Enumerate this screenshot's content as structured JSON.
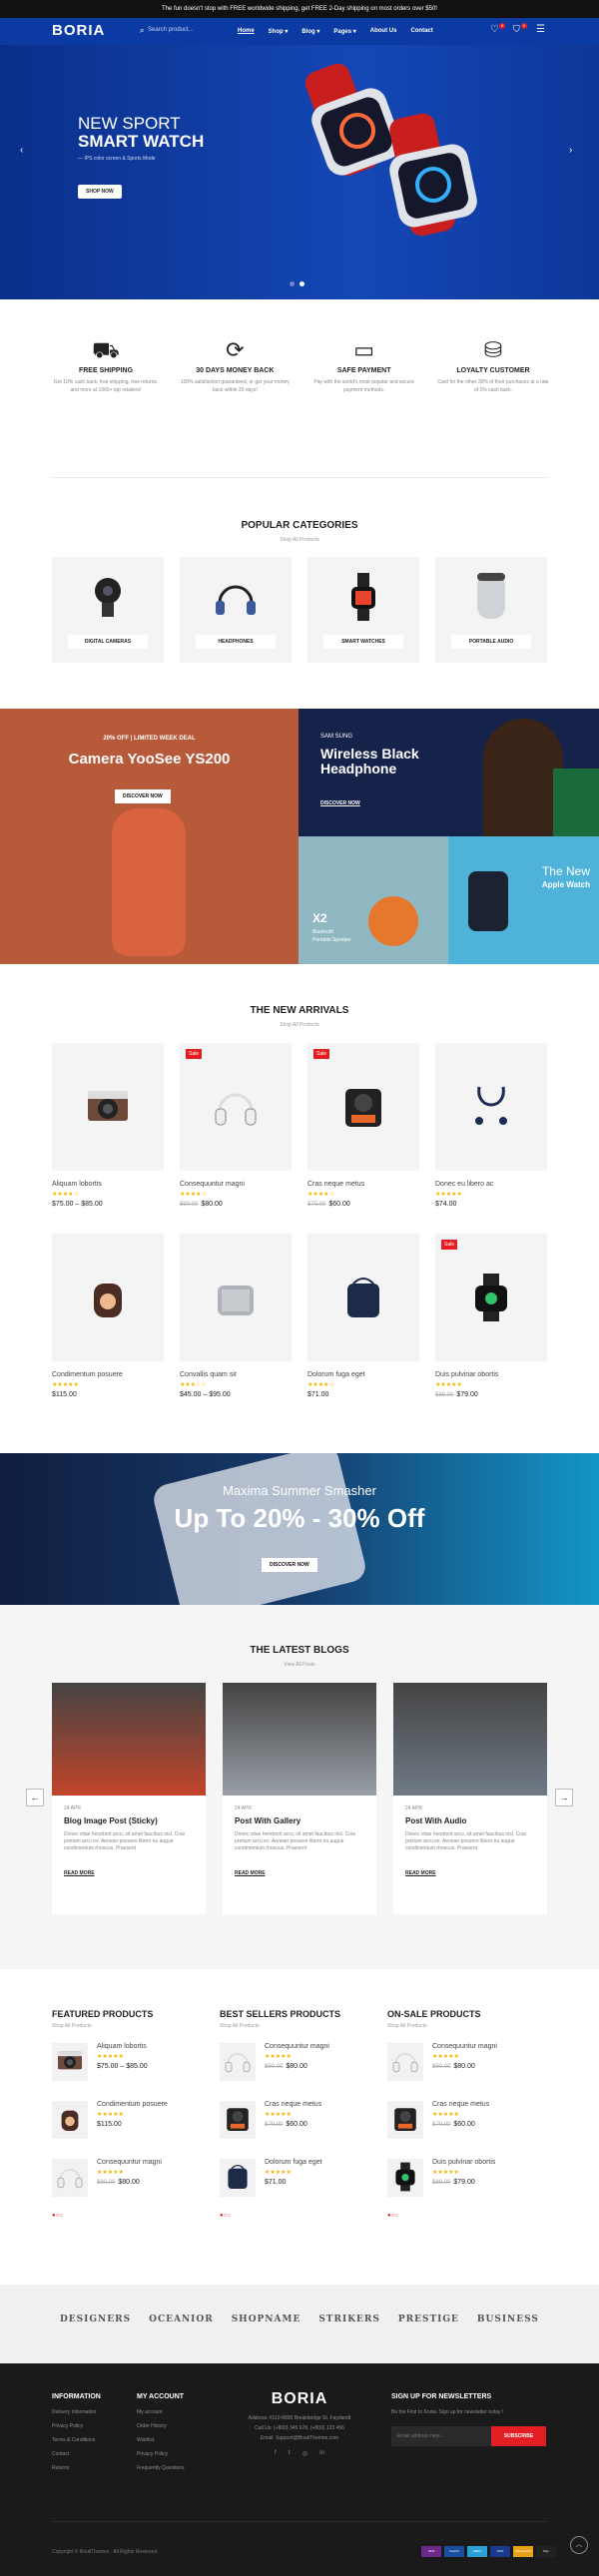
{
  "topbar": {
    "text": "The fun doesn't stop with FREE worldwide shipping, get FREE 2-Day shipping on most orders over $50!"
  },
  "header": {
    "logo": "BORIA",
    "search_placeholder": "Search product...",
    "nav": [
      "Home",
      "Shop",
      "Blog",
      "Pages",
      "About Us",
      "Contact"
    ],
    "cart_count": "0",
    "wishlist_count": "0"
  },
  "hero": {
    "title_line1": "NEW SPORT",
    "title_line2": "SMART WATCH",
    "subtitle": "IPS color screen & Sports Mode",
    "button": "SHOP NOW",
    "slide_count": 2,
    "active_slide": 2
  },
  "features": [
    {
      "icon": "truck-icon",
      "title": "FREE SHIPPING",
      "desc": "Get 10% cash back, free shipping, free returns, and more at 1000+ top retailers!"
    },
    {
      "icon": "money-back-icon",
      "title": "30 DAYS MONEY BACK",
      "desc": "100% satisfaction guaranteed, or get your money back within 30 days!"
    },
    {
      "icon": "payment-card-icon",
      "title": "SAFE PAYMENT",
      "desc": "Pay with the world's most popular and secure payment methods."
    },
    {
      "icon": "shopping-bag-icon",
      "title": "LOYALTY CUSTOMER",
      "desc": "Card for the other 30% of their purchases at a rate of 1% cash back."
    }
  ],
  "categories": {
    "title": "POPULAR CATEGORIES",
    "subtitle": "Shop All Products",
    "items": [
      "DIGITAL CAMERAS",
      "HEADPHONES",
      "SMART WATCHES",
      "PORTABLE AUDIO"
    ]
  },
  "promo": {
    "left_tag": "20% OFF | LIMITED WEEK DEAL",
    "left_title": "Camera YooSee YS200",
    "left_button": "DISCOVER NOW",
    "right_tag": "SAM SUNG",
    "right_title_line1": "Wireless Black",
    "right_title_line2": "Headphone",
    "right_button": "DISCOVER NOW",
    "small1_title": "X2",
    "small1_sub1": "Bluetooth",
    "small1_sub2": "Portable Speaker",
    "small2_title1": "The New",
    "small2_title2": "Apple Watch"
  },
  "arrivals": {
    "title": "THE NEW ARRIVALS",
    "subtitle": "Shop All Products",
    "sale_label": "Sale",
    "products": [
      {
        "name": "Aliquam lobortis",
        "rating": 4,
        "price": "$75.00 – $85.00",
        "old_price": "",
        "sale": false,
        "thumb": "camera"
      },
      {
        "name": "Consequuntur magni",
        "rating": 4,
        "price": "$80.00",
        "old_price": "$90.00",
        "sale": true,
        "thumb": "headphone"
      },
      {
        "name": "Cras neque metus",
        "rating": 4,
        "price": "$60.00",
        "old_price": "$70.00",
        "sale": true,
        "thumb": "action-cam"
      },
      {
        "name": "Donec eu libero ac",
        "rating": 5,
        "price": "$74.00",
        "old_price": "",
        "sale": false,
        "thumb": "earphone"
      },
      {
        "name": "Condimentum posuere",
        "rating": 5,
        "price": "$115.00",
        "old_price": "",
        "sale": false,
        "thumb": "speaker-brown"
      },
      {
        "name": "Convallis quam sit",
        "rating": 3,
        "price": "$45.00 – $95.00",
        "old_price": "",
        "sale": false,
        "thumb": "speaker-grey"
      },
      {
        "name": "Dolorum fuga eget",
        "rating": 4,
        "price": "$71.00",
        "old_price": "",
        "sale": false,
        "thumb": "speaker-navy"
      },
      {
        "name": "Duis pulvinar obortis",
        "rating": 5,
        "price": "$79.00",
        "old_price": "$89.00",
        "sale": true,
        "thumb": "watch"
      }
    ]
  },
  "banner": {
    "title": "Maxima Summer Smasher",
    "headline": "Up To 20% - 30% Off",
    "button": "DISCOVER NOW"
  },
  "blogs": {
    "title": "THE LATEST BLOGS",
    "subtitle": "View All Posts",
    "read_more": "READ MORE",
    "posts": [
      {
        "date": "24 APR",
        "title": "Blog Image Post (Sticky)",
        "excerpt": "Donec vitae hendrerit arcu, sit amet faucibus nisl. Cras pretium arcu ex. Aenean posuere libero eu augue condimentum rhoncus. Praesent"
      },
      {
        "date": "24 APR",
        "title": "Post With Gallery",
        "excerpt": "Donec vitae hendrerit arcu, sit amet faucibus nisl. Cras pretium arcu ex. Aenean posuere libero eu augue condimentum rhoncus. Praesent"
      },
      {
        "date": "24 APR",
        "title": "Post With Audio",
        "excerpt": "Donec vitae hendrerit arcu, sit amet faucibus nisl. Cras pretium arcu ex. Aenean posuere libero eu augue condimentum rhoncus. Praesent"
      }
    ]
  },
  "lists": [
    {
      "title": "FEATURED PRODUCTS",
      "subtitle": "Shop All Products",
      "items": [
        {
          "name": "Aliquam lobortis",
          "price": "$75.00 – $85.00",
          "old_price": "",
          "thumb": "camera"
        },
        {
          "name": "Condimentum posuere",
          "price": "$115.00",
          "old_price": "",
          "thumb": "speaker-brown"
        },
        {
          "name": "Consequuntur magni",
          "price": "$80.00",
          "old_price": "$90.00",
          "thumb": "headphone"
        }
      ]
    },
    {
      "title": "BEST SELLERS PRODUCTS",
      "subtitle": "Shop All Products",
      "items": [
        {
          "name": "Consequuntur magni",
          "price": "$80.00",
          "old_price": "$90.00",
          "thumb": "headphone"
        },
        {
          "name": "Cras neque metus",
          "price": "$60.00",
          "old_price": "$70.00",
          "thumb": "action-cam"
        },
        {
          "name": "Dolorum fuga eget",
          "price": "$71.00",
          "old_price": "",
          "thumb": "speaker-navy"
        }
      ]
    },
    {
      "title": "ON-SALE PRODUCTS",
      "subtitle": "Shop All Products",
      "items": [
        {
          "name": "Consequuntur magni",
          "price": "$80.00",
          "old_price": "$90.00",
          "thumb": "headphone"
        },
        {
          "name": "Cras neque metus",
          "price": "$60.00",
          "old_price": "$70.00",
          "thumb": "action-cam"
        },
        {
          "name": "Duis pulvinar obortis",
          "price": "$79.00",
          "old_price": "$89.00",
          "thumb": "watch"
        }
      ]
    }
  ],
  "brands": [
    "DESIGNERS",
    "OCEANIOR",
    "SHOPNAME",
    "STRIKERS",
    "PRESTIGE",
    "BUSINESS"
  ],
  "footer": {
    "info_title": "INFORMATION",
    "info_links": [
      "Delivery Information",
      "Privacy Policy",
      "Terms & Conditions",
      "Contact",
      "Returns"
    ],
    "account_title": "MY ACCOUNT",
    "account_links": [
      "My account",
      "Order History",
      "Wishlist",
      "Privacy Policy",
      "Frequently Questions"
    ],
    "logo": "BORIA",
    "address": "Address: #110-8800 Breakbridge St. Faydandt",
    "phone": "Call Us: (+800) 345 678, (+800) 123 456",
    "email": "Email: Support@BoutiThemes.com",
    "newsletter_title": "SIGN UP FOR NEWSLETTERS",
    "newsletter_text": "Be the First to Know. Sign up for newsletter today !",
    "newsletter_placeholder": "Email address here...",
    "subscribe": "SUBSCRIBE",
    "copyright": "Copyright © BoutiThemes . All Rights Reserved.",
    "payments": [
      "Skrill",
      "PayPal",
      "AMEX",
      "VISA",
      "MasterCard",
      "Pay"
    ]
  },
  "colors": {
    "brand": "#0b3aa3",
    "accent": "#e31e24",
    "promo_orange": "#b65a3a",
    "dark": "#111111"
  }
}
